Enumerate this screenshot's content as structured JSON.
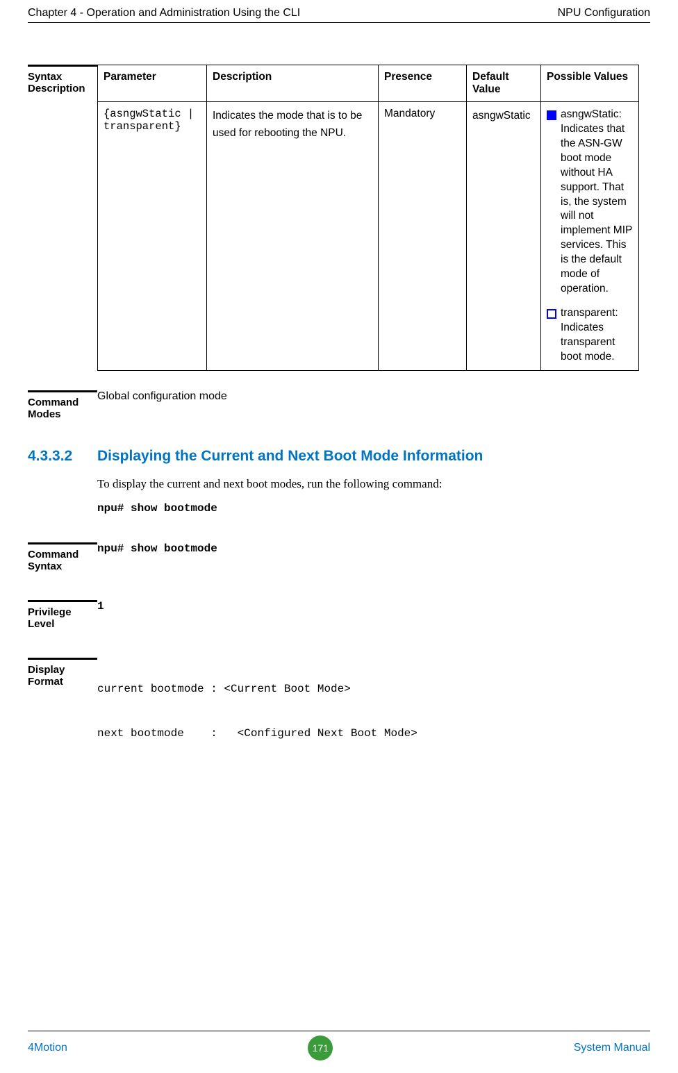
{
  "header": {
    "left": "Chapter 4 - Operation and Administration Using the CLI",
    "right": "NPU Configuration"
  },
  "syntax_desc": {
    "label": "Syntax Description",
    "headers": [
      "Parameter",
      "Description",
      "Presence",
      "Default Value",
      "Possible Values"
    ],
    "row": {
      "parameter": "{asngwStatic | transparent}",
      "description": "Indicates the mode that is to be used for rebooting the NPU.",
      "presence": "Mandatory",
      "default": "asngwStatic",
      "possible": [
        "asngwStatic: Indicates that the ASN-GW boot mode without HA support. That is, the system will not implement MIP services. This is the default mode of operation.",
        "transparent: Indicates transparent boot mode."
      ]
    }
  },
  "command_modes": {
    "label": "Command Modes",
    "value": "Global configuration mode"
  },
  "section": {
    "num": "4.3.3.2",
    "title": "Displaying the Current and Next Boot Mode Information"
  },
  "intro": "To display the current and next boot modes, run the following command:",
  "cmd": "npu# show bootmode",
  "command_syntax": {
    "label": "Command Syntax",
    "value": "npu# show bootmode"
  },
  "privilege": {
    "label": "Privilege Level",
    "value": "1"
  },
  "display_format": {
    "label": "Display Format",
    "line1": "current bootmode : <Current Boot Mode>",
    "line2": "next bootmode    :   <Configured Next Boot Mode>"
  },
  "footer": {
    "left": "4Motion",
    "page": "171",
    "right": "System Manual"
  }
}
